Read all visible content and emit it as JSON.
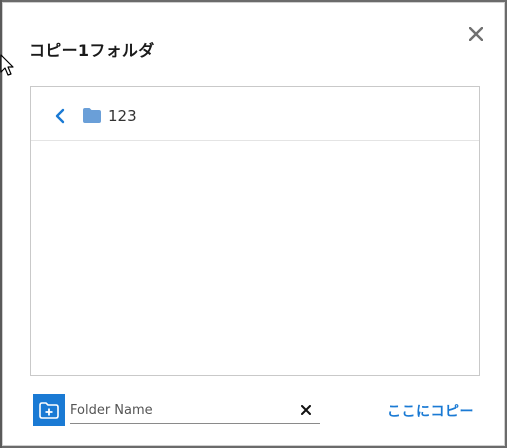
{
  "dialog": {
    "title": "コピー1フォルダ",
    "close_icon": "close-icon"
  },
  "browser": {
    "back_icon": "chevron-left-icon",
    "folder_icon": "folder-icon",
    "current_folder": "123"
  },
  "footer": {
    "new_folder_icon": "folder-plus-icon",
    "folder_name_value": "",
    "folder_name_placeholder": "Folder Name",
    "clear_icon": "close-icon",
    "copy_label": "ここにコピー"
  },
  "colors": {
    "accent": "#1a7ad4",
    "folder": "#6a9fd8",
    "backdrop": "#6b6b6b"
  }
}
